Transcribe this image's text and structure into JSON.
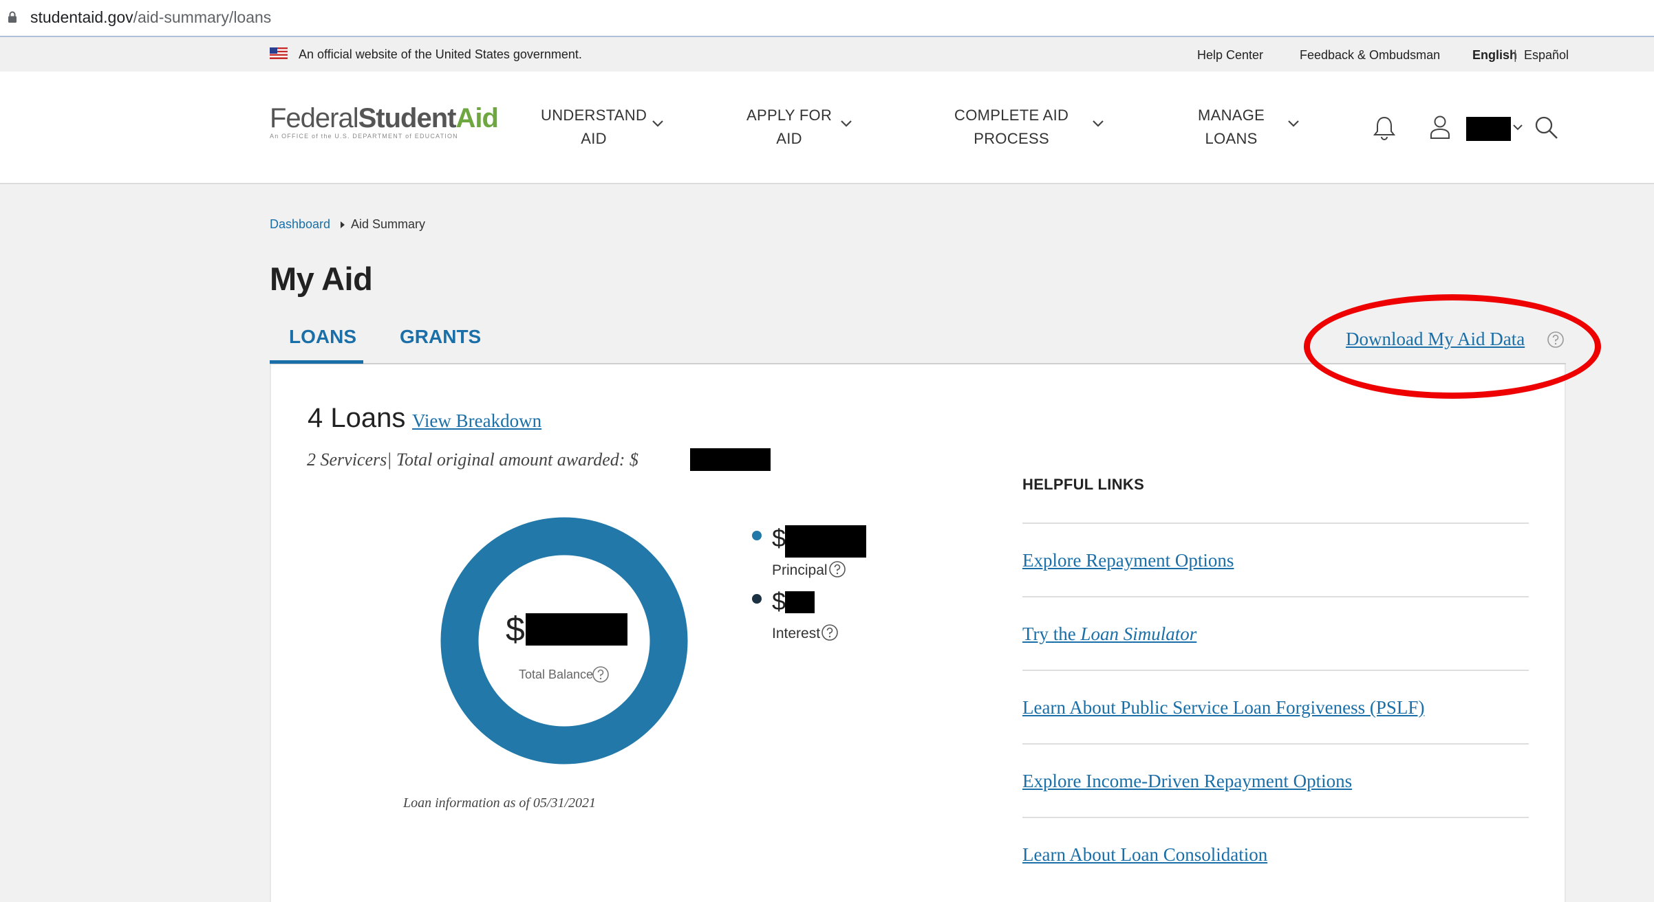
{
  "browser": {
    "url_domain": "studentaid.gov",
    "url_path": "/aid-summary/loans"
  },
  "gov_banner": {
    "text": "An official website of the United States government.",
    "help_center": "Help Center",
    "feedback": "Feedback & Ombudsman",
    "lang_english": "English",
    "lang_sep": "|",
    "lang_espanol": "Español"
  },
  "logo": {
    "part1": "Federal",
    "part2": "Student",
    "part3": "Aid",
    "tagline": "An OFFICE of the U.S. DEPARTMENT of EDUCATION"
  },
  "nav": {
    "understand_l1": "UNDERSTAND",
    "understand_l2": "AID",
    "apply_l1": "APPLY FOR",
    "apply_l2": "AID",
    "complete_l1": "COMPLETE AID",
    "complete_l2": "PROCESS",
    "manage_l1": "MANAGE",
    "manage_l2": "LOANS"
  },
  "breadcrumb": {
    "dashboard": "Dashboard",
    "current": "Aid Summary"
  },
  "page_title": "My Aid",
  "tabs": {
    "loans": "LOANS",
    "grants": "GRANTS"
  },
  "download_link": "Download My Aid Data",
  "summary": {
    "loan_count": "4 Loans",
    "view_breakdown": "View Breakdown",
    "servicers_text": "2 Servicers| Total original amount awarded: $"
  },
  "balance": {
    "currency": "$",
    "total_label": "Total Balance",
    "principal_label": "Principal",
    "interest_label": "Interest",
    "as_of": "Loan information as of 05/31/2021"
  },
  "helpful_links": {
    "heading": "HELPFUL LINKS",
    "link1": "Explore Repayment Options",
    "link2_prefix": "Try the ",
    "link2_italic": "Loan Simulator",
    "link3": "Learn About Public Service Loan Forgiveness (PSLF)",
    "link4": "Explore Income-Driven Repayment Options",
    "link5": "Learn About Loan Consolidation"
  },
  "colors": {
    "brand_blue": "#1a6fa8",
    "donut_blue": "#2278a8",
    "interest_dot": "#1c3142",
    "logo_green": "#6ea63f",
    "annotation_red": "#ee0000"
  },
  "icons": {
    "lock": "lock-icon",
    "flag": "us-flag-icon",
    "bell": "bell-icon",
    "user": "user-icon",
    "search": "search-icon",
    "chevron": "chevron-down-icon",
    "help": "question-circle-icon"
  }
}
